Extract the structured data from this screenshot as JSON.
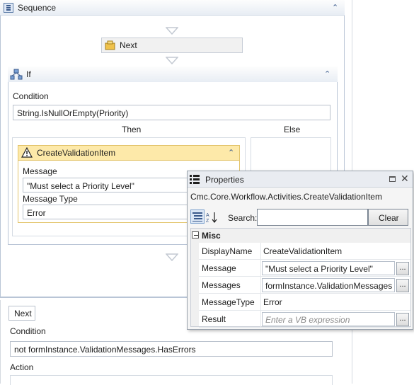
{
  "sequence": {
    "title": "Sequence"
  },
  "next_activity": {
    "label": "Next"
  },
  "if_activity": {
    "title": "If",
    "condition_label": "Condition",
    "condition_value": "String.IsNullOrEmpty(Priority)",
    "then_label": "Then",
    "else_label": "Else"
  },
  "validation_item": {
    "title": "CreateValidationItem",
    "message_label": "Message",
    "message_value": "\"Must select a Priority Level\"",
    "message_type_label": "Message Type",
    "message_type_value": "Error"
  },
  "transition": {
    "next_button": "Next",
    "condition_label": "Condition",
    "condition_value": "not formInstance.ValidationMessages.HasErrors",
    "action_label": "Action"
  },
  "properties": {
    "title": "Properties",
    "type_name": "Cmc.Core.Workflow.Activities.CreateValidationItem",
    "search_label": "Search:",
    "search_value": "",
    "clear_label": "Clear",
    "category": "Misc",
    "rows": [
      {
        "name": "DisplayName",
        "value": "CreateValidationItem",
        "has_button": false,
        "is_placeholder": false
      },
      {
        "name": "Message",
        "value": "\"Must select a Priority Level\"",
        "has_button": true,
        "is_placeholder": false
      },
      {
        "name": "Messages",
        "value": "formInstance.ValidationMessages",
        "has_button": true,
        "is_placeholder": false
      },
      {
        "name": "MessageType",
        "value": "Error",
        "has_button": false,
        "is_placeholder": false
      },
      {
        "name": "Result",
        "value": "Enter a VB expression",
        "has_button": true,
        "is_placeholder": true
      }
    ],
    "ellipsis_label": "..."
  },
  "colors": {
    "header_gradient_top": "#fdfdfd",
    "header_gradient_bottom": "#e8edf4",
    "activity_border": "#9fb0c7",
    "validation_header": "#fde9a9",
    "validation_border": "#e3c46b",
    "selected_next": "#f3f3f3",
    "panel_bg": "#f5f5f5"
  }
}
